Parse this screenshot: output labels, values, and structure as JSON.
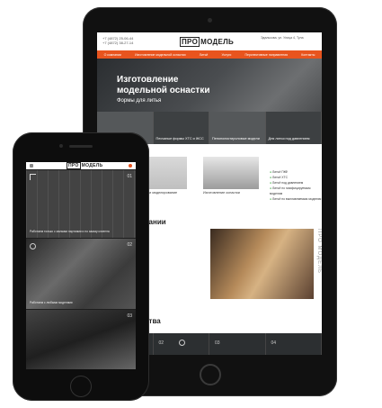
{
  "tablet": {
    "header": {
      "phones": [
        "+7 (4872) 25-06-44",
        "+7 (4872) 38-27-14"
      ],
      "logo_box": "ПРО",
      "logo_text": "МОДЕЛЬ",
      "address": "Эдалькова, ул. Улица 4, Тула"
    },
    "nav": [
      "О компании",
      "Изготовление модельной оснастки",
      "Литьё",
      "Услуги",
      "Перспективные направления",
      "Контакты"
    ],
    "hero": {
      "title": "Изготовление модельной оснастки",
      "subtitle": "Формы для литья",
      "cards": [
        "ПКФ и ЛКФ",
        "Песчаные формы ХТС и ЖСС",
        "Пенополистироловые модели",
        "Для литья под давлением"
      ]
    },
    "services": {
      "tile1": "3D модели и моделирование",
      "tile2": "Изготовление оснастки",
      "list": [
        "Литьё ПКФ",
        "Литьё ХТС",
        "Литьё под давлением",
        "Литьё по газифицируемым моделям",
        "Литьё по выплавляемым моделям"
      ]
    },
    "about_heading": "омпании",
    "vertical_text": "ПРО МОДЕЛЬ",
    "advantages_heading": "щества",
    "bottom_numbers": [
      "01",
      "02",
      "03",
      "04"
    ]
  },
  "phone": {
    "logo_box": "ПРО",
    "logo_text": "МОДЕЛЬ",
    "panels": [
      {
        "num": "01",
        "caption": "Работаем только с малыми партиями и по заказу клиента"
      },
      {
        "num": "02",
        "caption": "Работаем с любыми моделями"
      },
      {
        "num": "03",
        "caption": ""
      }
    ]
  },
  "colors": {
    "accent": "#e8541e",
    "dark": "#2c2f31"
  }
}
